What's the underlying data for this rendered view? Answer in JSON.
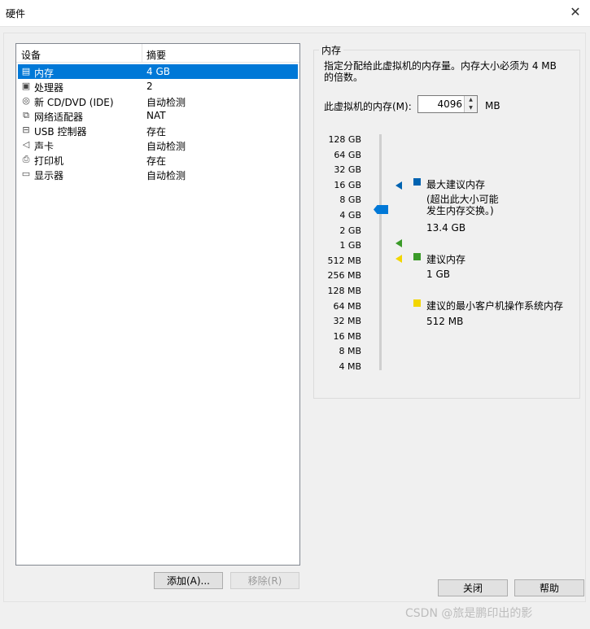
{
  "window": {
    "title": "硬件",
    "close_glyph": "✕"
  },
  "devices": {
    "header": {
      "device": "设备",
      "summary": "摘要"
    },
    "rows": [
      {
        "name": "内存",
        "summary": "4 GB",
        "icon": "memory-icon",
        "selected": true
      },
      {
        "name": "处理器",
        "summary": "2",
        "icon": "cpu-icon",
        "selected": false
      },
      {
        "name": "新 CD/DVD (IDE)",
        "summary": "自动检测",
        "icon": "cd-dvd-icon",
        "selected": false
      },
      {
        "name": "网络适配器",
        "summary": "NAT",
        "icon": "network-icon",
        "selected": false
      },
      {
        "name": "USB 控制器",
        "summary": "存在",
        "icon": "usb-icon",
        "selected": false
      },
      {
        "name": "声卡",
        "summary": "自动检测",
        "icon": "speaker-icon",
        "selected": false
      },
      {
        "name": "打印机",
        "summary": "存在",
        "icon": "printer-icon",
        "selected": false
      },
      {
        "name": "显示器",
        "summary": "自动检测",
        "icon": "monitor-icon",
        "selected": false
      }
    ],
    "add_button": "添加(A)...",
    "remove_button": "移除(R)"
  },
  "memory": {
    "group_title": "内存",
    "description": "指定分配给此虚拟机的内存量。内存大小必须为 4 MB 的倍数。",
    "field_label": "此虚拟机的内存(M):",
    "value": "4096",
    "unit": "MB",
    "scale_labels": [
      "128 GB",
      "64 GB",
      "32 GB",
      "16 GB",
      "8 GB",
      "4 GB",
      "2 GB",
      "1 GB",
      "512 MB",
      "256 MB",
      "128 MB",
      "64 MB",
      "32 MB",
      "16 MB",
      "8 MB",
      "4 MB"
    ],
    "max_recommended": {
      "label": "最大建议内存",
      "note": "(超出此大小可能发生内存交换。)",
      "value": "13.4 GB",
      "color": "#0063b1"
    },
    "recommended": {
      "label": "建议内存",
      "value": "1 GB",
      "color": "#3a9a28"
    },
    "min_guest": {
      "label": "建议的最小客户机操作系统内存",
      "value": "512 MB",
      "color": "#f2d600"
    }
  },
  "footer": {
    "close_button": "关闭",
    "help_button": "帮助",
    "watermark": "CSDN @旅是鹏印出的影"
  }
}
